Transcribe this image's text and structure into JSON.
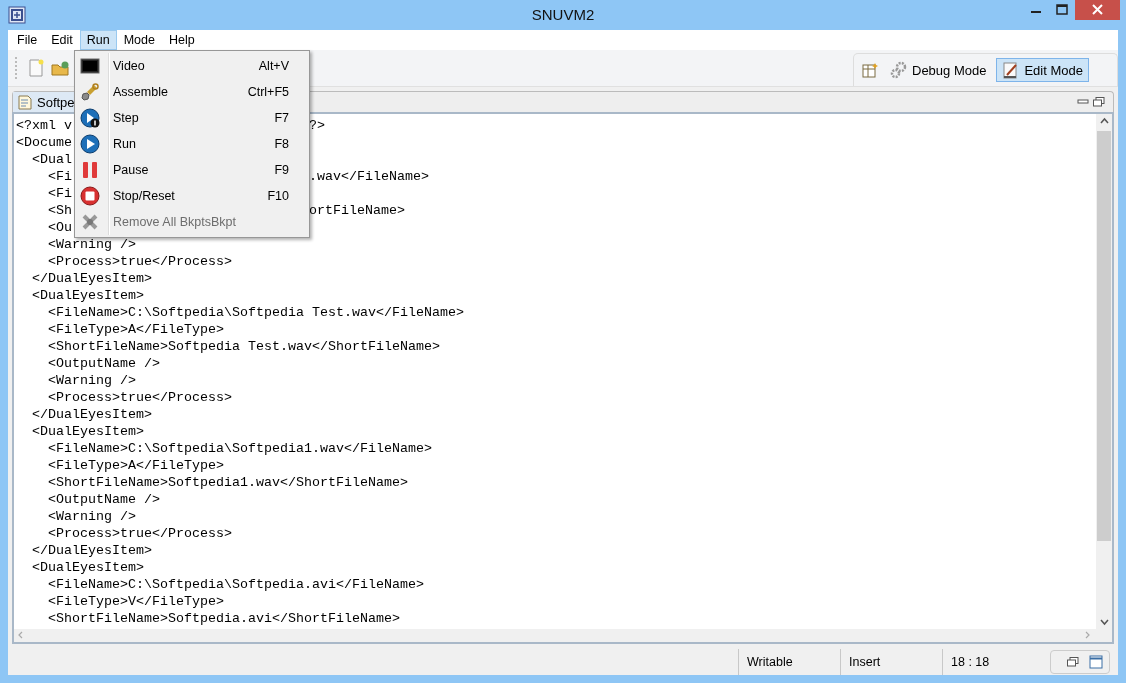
{
  "window": {
    "title": "SNUVM2"
  },
  "menu_bar": [
    {
      "label": "File",
      "selected": false
    },
    {
      "label": "Edit",
      "selected": false
    },
    {
      "label": "Run",
      "selected": true
    },
    {
      "label": "Mode",
      "selected": false
    },
    {
      "label": "Help",
      "selected": false
    }
  ],
  "run_menu": {
    "items": [
      {
        "label": "Video",
        "shortcut": "Alt+V",
        "disabled": false
      },
      {
        "label": "Assemble",
        "shortcut": "Ctrl+F5",
        "disabled": false
      },
      {
        "label": "Step",
        "shortcut": "F7",
        "disabled": false
      },
      {
        "label": "Run",
        "shortcut": "F8",
        "disabled": false
      },
      {
        "label": "Pause",
        "shortcut": "F9",
        "disabled": false
      },
      {
        "label": "Stop/Reset",
        "shortcut": "F10",
        "disabled": false
      },
      {
        "label": "Remove All BkptsBkpt",
        "disabled": true
      }
    ]
  },
  "perspectives": [
    {
      "label": "Debug Mode",
      "selected": false
    },
    {
      "label": "Edit Mode",
      "selected": true
    }
  ],
  "editor_tab": {
    "label": "Softpe"
  },
  "editor": {
    "lines": [
      {
        "text": "<?xml v",
        "tail": "?>"
      },
      {
        "text": "<Docume"
      },
      {
        "text": "  <Dual"
      },
      {
        "text": "    <Fi",
        "tail": ".wav</FileName>"
      },
      {
        "text": "    <Fi"
      },
      {
        "text": "    <Sh",
        "tail": "ortFileName>"
      },
      {
        "text": "    <Ou"
      },
      {
        "text": "    <Warning />"
      },
      {
        "text": "    <Process>true</Process>"
      },
      {
        "text": "  </DualEyesItem>"
      },
      {
        "text": "  <DualEyesItem>"
      },
      {
        "text": "    <FileName>C:\\Softpedia\\Softpedia Test.wav</FileName>"
      },
      {
        "text": "    <FileType>A</FileType>"
      },
      {
        "text": "    <ShortFileName>Softpedia Test.wav</ShortFileName>"
      },
      {
        "text": "    <OutputName />"
      },
      {
        "text": "    <Warning />"
      },
      {
        "text": "    <Process>true</Process>"
      },
      {
        "text": "  </DualEyesItem>"
      },
      {
        "text": "  <DualEyesItem>"
      },
      {
        "text": "    <FileName>C:\\Softpedia\\Softpedia1.wav</FileName>"
      },
      {
        "text": "    <FileType>A</FileType>"
      },
      {
        "text": "    <ShortFileName>Softpedia1.wav</ShortFileName>"
      },
      {
        "text": "    <OutputName />"
      },
      {
        "text": "    <Warning />"
      },
      {
        "text": "    <Process>true</Process>"
      },
      {
        "text": "  </DualEyesItem>"
      },
      {
        "text": "  <DualEyesItem>"
      },
      {
        "text": "    <FileName>C:\\Softpedia\\Softpedia.avi</FileName>"
      },
      {
        "text": "    <FileType>V</FileType>"
      },
      {
        "text": "    <ShortFileName>Softpedia.avi</ShortFileName>"
      }
    ]
  },
  "status_bar": [
    "Writable",
    "Insert",
    "18 : 18"
  ]
}
